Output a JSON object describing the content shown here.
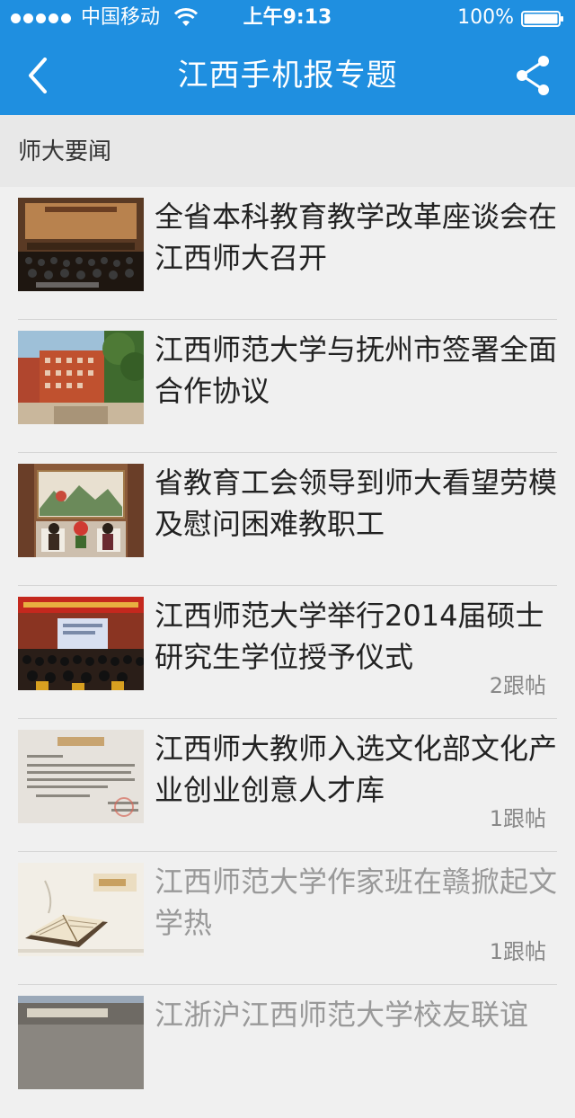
{
  "status_bar": {
    "carrier": "中国移动",
    "time": "上午9:13",
    "battery": "100%"
  },
  "nav": {
    "title": "江西手机报专题",
    "back_icon": "chevron-left-icon",
    "share_icon": "share-icon"
  },
  "section": {
    "title": "师大要闻"
  },
  "news": [
    {
      "title": "全省本科教育教学改革座谈会在江西师大召开",
      "count": ""
    },
    {
      "title": "江西师范大学与抚州市签署全面合作协议",
      "count": ""
    },
    {
      "title": "省教育工会领导到师大看望劳模及慰问困难教职工",
      "count": ""
    },
    {
      "title": "江西师范大学举行2014届硕士研究生学位授予仪式",
      "count": "2跟帖"
    },
    {
      "title": "江西师大教师入选文化部文化产业创业创意人才库",
      "count": "1跟帖"
    },
    {
      "title": "江西师范大学作家班在赣掀起文学热",
      "count": "1跟帖"
    },
    {
      "title": "江浙沪江西师范大学校友联谊",
      "count": ""
    }
  ],
  "colors": {
    "header_bg": "#1f8fe0",
    "section_bg": "#e8e8e8",
    "list_bg": "#f0f0f0",
    "title_text": "#222222",
    "read_text": "#999999"
  }
}
